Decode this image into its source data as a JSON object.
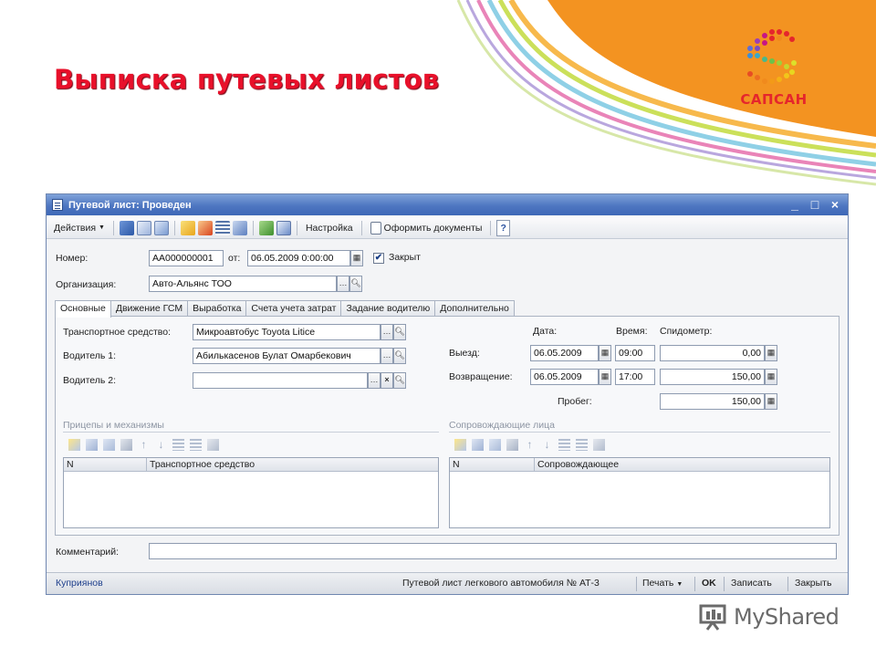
{
  "slide": {
    "title": "Выписка путевых листов",
    "logo_text": "САПСАН",
    "watermark": "MyShared",
    "accent_red": "#e8102a",
    "accent_orange": "#f08a1d"
  },
  "window": {
    "title": "Путевой лист: Проведен",
    "buttons": {
      "minimize": "_",
      "maximize": "□",
      "close": "×"
    }
  },
  "toolbar": {
    "actions_label": "Действия",
    "settings_label": "Настройка",
    "make_docs_label": "Оформить документы",
    "help_label": "?",
    "icons": [
      "arrow-left-icon",
      "add-copy-icon",
      "refresh-icon",
      "post-icon",
      "cancel-post-icon",
      "list-icon",
      "structure-icon",
      "tree-icon",
      "report-icon"
    ]
  },
  "header": {
    "number_label": "Номер:",
    "number_value": "АА000000001",
    "date_label": "от:",
    "date_value": "06.05.2009  0:00:00",
    "closed_label": "Закрыт",
    "closed_checked": true,
    "org_label": "Организация:",
    "org_value": "Авто-Альянс ТОО"
  },
  "tabs": [
    {
      "label": "Основные",
      "active": true
    },
    {
      "label": "Движение ГСМ",
      "active": false
    },
    {
      "label": "Выработка",
      "active": false
    },
    {
      "label": "Счета учета затрат",
      "active": false
    },
    {
      "label": "Задание водителю",
      "active": false
    },
    {
      "label": "Дополнительно",
      "active": false
    }
  ],
  "main": {
    "vehicle_label": "Транспортное средство:",
    "vehicle_value": "Микроавтобус Toyota Litice",
    "driver1_label": "Водитель 1:",
    "driver1_value": "Абилькасенов Булат Омарбекович",
    "driver2_label": "Водитель 2:",
    "driver2_value": "",
    "col_date": "Дата:",
    "col_time": "Время:",
    "col_odometer": "Спидометр:",
    "depart_label": "Выезд:",
    "depart_date": "06.05.2009",
    "depart_time": "09:00",
    "depart_odometer": "0,00",
    "return_label": "Возвращение:",
    "return_date": "06.05.2009",
    "return_time": "17:00",
    "return_odometer": "150,00",
    "mileage_label": "Пробег:",
    "mileage_value": "150,00"
  },
  "trailers": {
    "title": "Прицепы и механизмы",
    "col_n": "N",
    "col_vehicle": "Транспортное средство"
  },
  "escorts": {
    "title": "Сопровождающие лица",
    "col_n": "N",
    "col_person": "Сопровождающее"
  },
  "comment": {
    "label": "Комментарий:",
    "value": ""
  },
  "status": {
    "user": "Куприянов",
    "form_name": "Путевой лист легкового автомобиля № АТ-3",
    "print_label": "Печать",
    "ok_label": "OK",
    "save_label": "Записать",
    "close_label": "Закрыть"
  }
}
